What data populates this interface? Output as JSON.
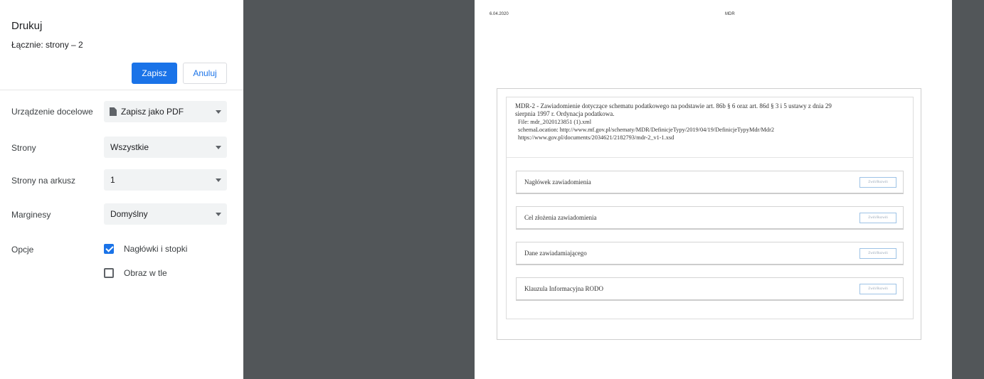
{
  "panel": {
    "title": "Drukuj",
    "total": "Łącznie: strony – 2",
    "save_label": "Zapisz",
    "cancel_label": "Anuluj",
    "rows": {
      "destination": {
        "label": "Urządzenie docelowe",
        "value": "Zapisz jako PDF",
        "icon": "pdf-file-icon"
      },
      "pages": {
        "label": "Strony",
        "value": "Wszystkie"
      },
      "per_sheet": {
        "label": "Strony na arkusz",
        "value": "1"
      },
      "margins": {
        "label": "Marginesy",
        "value": "Domyślny"
      },
      "options": {
        "label": "Opcje",
        "headers_footers": {
          "label": "Nagłówki i stopki",
          "checked": true
        },
        "background": {
          "label": "Obraz w tle",
          "checked": false
        }
      }
    },
    "accent_color": "#1a73e8"
  },
  "preview": {
    "header_date": "6.04.2020",
    "header_title": "MDR",
    "doc_title_line1": "MDR-2 - Zawiadomienie dotyczące schematu podatkowego na podstawie art. 86b § 6 oraz art. 86d § 3 i 5 ustawy z dnia 29",
    "doc_title_line2": "sierpnia 1997 r. Ordynacja podatkowa.",
    "file": "File: mdr_2020123851 (1).xml",
    "schema_location": "schemaLocation: http://www.mf.gov.pl/schematy/MDR/DefinicjeTypy/2019/04/19/DefinicjeTypyMdr/Mdr2",
    "doc_url": "https://www.gov.pl/documents/2034621/2182793/mdr-2_v1-1.xsd",
    "sections": [
      {
        "label": "Nagłówek zawiadomienia",
        "toggle": "Zwiń/Rozwiń"
      },
      {
        "label": "Cel złożenia zawiadomienia",
        "toggle": "Zwiń/Rozwiń"
      },
      {
        "label": "Dane zawiadamiającego",
        "toggle": "Zwiń/Rozwiń"
      },
      {
        "label": "Klauzula Informacyjna RODO",
        "toggle": "Zwiń/Rozwiń"
      }
    ]
  },
  "colors": {
    "viewer_background": "#525659"
  }
}
